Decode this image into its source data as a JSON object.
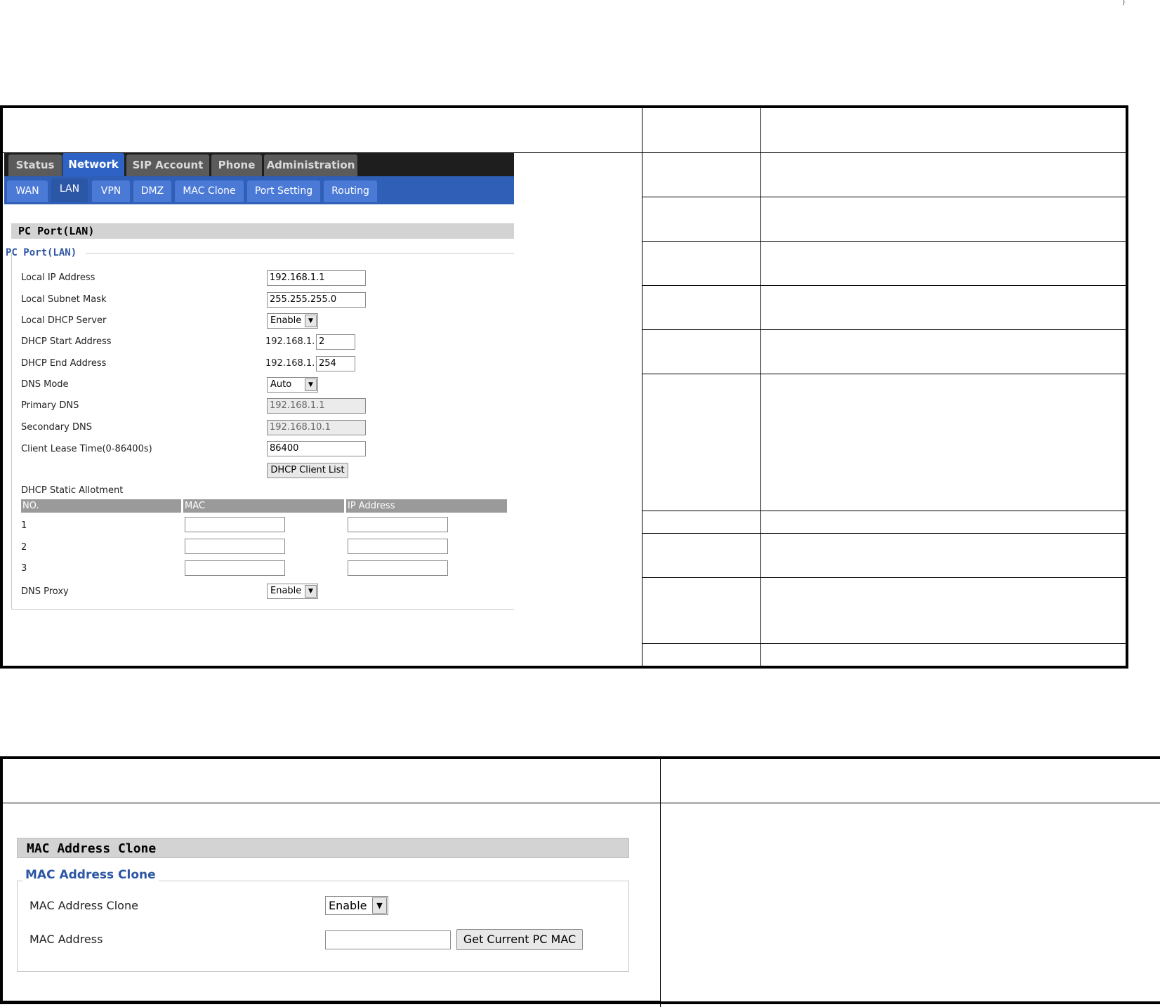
{
  "page_marker": ")",
  "router_ui": {
    "top_tabs": [
      "Status",
      "Network",
      "SIP Account",
      "Phone",
      "Administration"
    ],
    "active_top_tab": "Network",
    "sub_tabs": [
      "WAN",
      "LAN",
      "VPN",
      "DMZ",
      "MAC Clone",
      "Port Setting",
      "Routing"
    ],
    "active_sub_tab": "LAN",
    "section_header": "PC Port(LAN)",
    "fieldset_legend": "PC Port(LAN)",
    "fields": {
      "local_ip": {
        "label": "Local IP Address",
        "value": "192.168.1.1"
      },
      "subnet_mask": {
        "label": "Local Subnet Mask",
        "value": "255.255.255.0"
      },
      "dhcp_server": {
        "label": "Local DHCP Server",
        "value": "Enable"
      },
      "dhcp_start": {
        "label": "DHCP Start Address",
        "prefix": "192.168.1.",
        "value": "2"
      },
      "dhcp_end": {
        "label": "DHCP End Address",
        "prefix": "192.168.1.",
        "value": "254"
      },
      "dns_mode": {
        "label": "DNS Mode",
        "value": "Auto"
      },
      "primary_dns": {
        "label": "Primary DNS",
        "value": "192.168.1.1"
      },
      "secondary_dns": {
        "label": "Secondary DNS",
        "value": "192.168.10.1"
      },
      "lease_time": {
        "label": "Client Lease Time(0-86400s)",
        "value": "86400"
      }
    },
    "dhcp_client_list_button": "DHCP Client List",
    "static_allotment": {
      "label": "DHCP Static Allotment",
      "columns": [
        "NO.",
        "MAC",
        "IP Address"
      ],
      "rows": [
        "1",
        "2",
        "3"
      ]
    },
    "dns_proxy": {
      "label": "DNS Proxy",
      "value": "Enable"
    }
  },
  "mac_clone_ui": {
    "section_header": "MAC Address Clone",
    "fieldset_legend": "MAC Address Clone",
    "clone": {
      "label": "MAC Address Clone",
      "value": "Enable"
    },
    "mac": {
      "label": "MAC Address",
      "value": ""
    },
    "get_mac_button": "Get Current PC MAC"
  }
}
